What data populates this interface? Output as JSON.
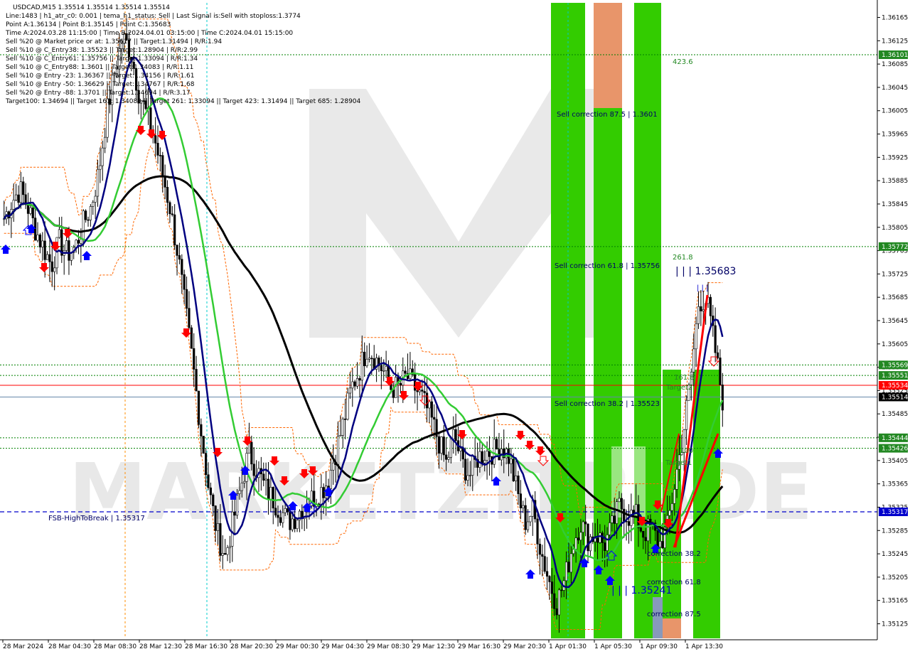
{
  "header": {
    "symbol_line": "USDCAD,M15  1.35514 1.35514 1.35514 1.35514",
    "lines": [
      "Line:1483 | h1_atr_c0: 0.001 | tema_h1_status: Sell | Last Signal is:Sell with stoploss:1.3774",
      "Point A:1.36134 | Point B:1.35145 | Point C:1.35683",
      "Time A:2024.03.28 11:15:00 | Time B:2024.04.01 03:15:00 | Time C:2024.04.01 15:15:00",
      "Sell %20 @ Market price or at: 1.35617 || Target:1.31494 | R/R:1.94",
      "Sell %10 @ C_Entry38: 1.35523 || Target:1.28904 | R/R:2.99",
      "Sell %10 @ C_Entry61: 1.35756 || Target:1.33094 | R/R:1.34",
      "Sell %10 @ C_Entry88: 1.3601 || Target:1.34083 | R/R:1.11",
      "Sell %10 @ Entry -23: 1.36367 || Target:1.34156 | R/R:1.61",
      "Sell %10 @ Entry -50: 1.36629 || Target:1.34767 | R/R:1.68",
      "Sell %20 @ Entry -88: 1.3701 || Target:1.34694 | R/R:3.17",
      "Target100: 1.34694 || Target 161: 1.34083 || Target 261: 1.33094 || Target 423: 1.31494 || Target 685: 1.28904"
    ]
  },
  "annotations": {
    "t423": "423.6",
    "sell_corr_875": "Sell correction 87.5 | 1.3601",
    "t261": "261.8",
    "point_c": "| | | 1.35683",
    "point_c_marks": "| | |",
    "sell_corr_618": "Sell correction 61.8 | 1.35756",
    "t1618": "161.8",
    "target2": "Target2",
    "sell_corr_382": "Sell correction 38.2 | 1.35523",
    "t100": "100",
    "target1": "Target1",
    "fsb": "FSB-HighToBreak | 1.35317",
    "corr382": "correction 38.2",
    "point_b": "| | | 1.35241",
    "corr618": "correction 61.8",
    "corr875": "correction 87.5",
    "watermark": "MARKETZITRADE"
  },
  "price_tags": {
    "p1": "1.36101",
    "p2": "1.35772",
    "p3": "1.35569",
    "p4": "1.35551",
    "p5": "1.35534",
    "p6": "1.35514",
    "p7": "1.35444",
    "p8": "1.35426",
    "p9": "1.35317"
  },
  "colors": {
    "background": "#ffffff",
    "green_zone": "#33cc00",
    "orange_zone": "#e8956a",
    "black_ma": "#000000",
    "navy_ma": "#000080",
    "green_ma": "#33cc33",
    "red_line": "#ff0000",
    "level_green": "#008000",
    "fsb_blue": "#0000cc"
  },
  "chart_data": {
    "type": "candlestick",
    "symbol": "USDCAD",
    "timeframe": "M15",
    "ylim": [
      1.351,
      1.3619
    ],
    "y_ticks": [
      "1.36165",
      "1.36125",
      "1.36085",
      "1.36045",
      "1.36005",
      "1.35965",
      "1.35925",
      "1.35885",
      "1.35845",
      "1.35805",
      "1.35765",
      "1.35725",
      "1.35685",
      "1.35645",
      "1.35605",
      "1.35565",
      "1.35525",
      "1.35485",
      "1.35445",
      "1.35405",
      "1.35365",
      "1.35325",
      "1.35285",
      "1.35245",
      "1.35205",
      "1.35165",
      "1.35125"
    ],
    "x_ticks": [
      "28 Mar 2024",
      "28 Mar 04:30",
      "28 Mar 08:30",
      "28 Mar 12:30",
      "28 Mar 16:30",
      "28 Mar 20:30",
      "29 Mar 00:30",
      "29 Mar 04:30",
      "29 Mar 08:30",
      "29 Mar 12:30",
      "29 Mar 16:30",
      "29 Mar 20:30",
      "1 Apr 01:30",
      "1 Apr 05:30",
      "1 Apr 09:30",
      "1 Apr 13:30"
    ],
    "close_path": [
      1.3582,
      1.3585,
      1.3587,
      1.3584,
      1.358,
      1.3577,
      1.3574,
      1.3578,
      1.3576,
      1.3577,
      1.3581,
      1.3584,
      1.359,
      1.36,
      1.3607,
      1.3613,
      1.3611,
      1.3604,
      1.36,
      1.3596,
      1.359,
      1.3584,
      1.3576,
      1.3566,
      1.3556,
      1.3545,
      1.3535,
      1.3528,
      1.3524,
      1.353,
      1.3536,
      1.3542,
      1.3539,
      1.3536,
      1.3534,
      1.3532,
      1.353,
      1.3531,
      1.3533,
      1.3534,
      1.3535,
      1.3537,
      1.3542,
      1.3547,
      1.3553,
      1.3556,
      1.356,
      1.3558,
      1.3556,
      1.3553,
      1.3553,
      1.3555,
      1.3553,
      1.3551,
      1.3548,
      1.3544,
      1.354,
      1.3545,
      1.354,
      1.3538,
      1.3541,
      1.3542,
      1.3542,
      1.3543,
      1.3541,
      1.3535,
      1.353,
      1.3532,
      1.3525,
      1.352,
      1.3516,
      1.352,
      1.3526,
      1.353,
      1.3527,
      1.3528,
      1.3526,
      1.3529,
      1.3533,
      1.3531,
      1.3531,
      1.3528,
      1.3529,
      1.3526,
      1.3529,
      1.3537,
      1.3545,
      1.3555,
      1.3568,
      1.3568,
      1.356,
      1.3551
    ],
    "levels": {
      "l_36101": 1.36101,
      "l_35772": 1.35772,
      "l_35569": 1.35569,
      "l_35551": 1.35551,
      "l_35534": 1.35534,
      "l_35514": 1.35514,
      "l_35444": 1.35444,
      "l_35426": 1.35426,
      "l_35317": 1.35317
    },
    "signals_down": [
      [
        62,
        378
      ],
      [
        78,
        348
      ],
      [
        95,
        330
      ],
      [
        198,
        185
      ],
      [
        213,
        190
      ],
      [
        228,
        192
      ],
      [
        262,
        470
      ],
      [
        306,
        638
      ],
      [
        348,
        622
      ],
      [
        386,
        650
      ],
      [
        400,
        678
      ],
      [
        428,
        668
      ],
      [
        440,
        664
      ],
      [
        548,
        538
      ],
      [
        568,
        558
      ],
      [
        588,
        545
      ],
      [
        650,
        613
      ],
      [
        732,
        614
      ],
      [
        745,
        628
      ],
      [
        760,
        636
      ],
      [
        788,
        730
      ],
      [
        903,
        735
      ],
      [
        925,
        712
      ],
      [
        940,
        738
      ]
    ],
    "signals_up": [
      [
        8,
        349
      ],
      [
        44,
        320
      ],
      [
        122,
        358
      ],
      [
        328,
        695
      ],
      [
        345,
        660
      ],
      [
        412,
        710
      ],
      [
        432,
        712
      ],
      [
        462,
        690
      ],
      [
        698,
        675
      ],
      [
        746,
        806
      ],
      [
        822,
        790
      ],
      [
        842,
        800
      ],
      [
        858,
        815
      ],
      [
        922,
        770
      ],
      [
        1010,
        636
      ]
    ],
    "signals_hollow_down": [
      [
        598,
        565
      ],
      [
        764,
        650
      ],
      [
        1004,
        510
      ]
    ],
    "signals_hollow_up": [
      [
        40,
        322
      ],
      [
        438,
        712
      ],
      [
        860,
        780
      ]
    ]
  }
}
